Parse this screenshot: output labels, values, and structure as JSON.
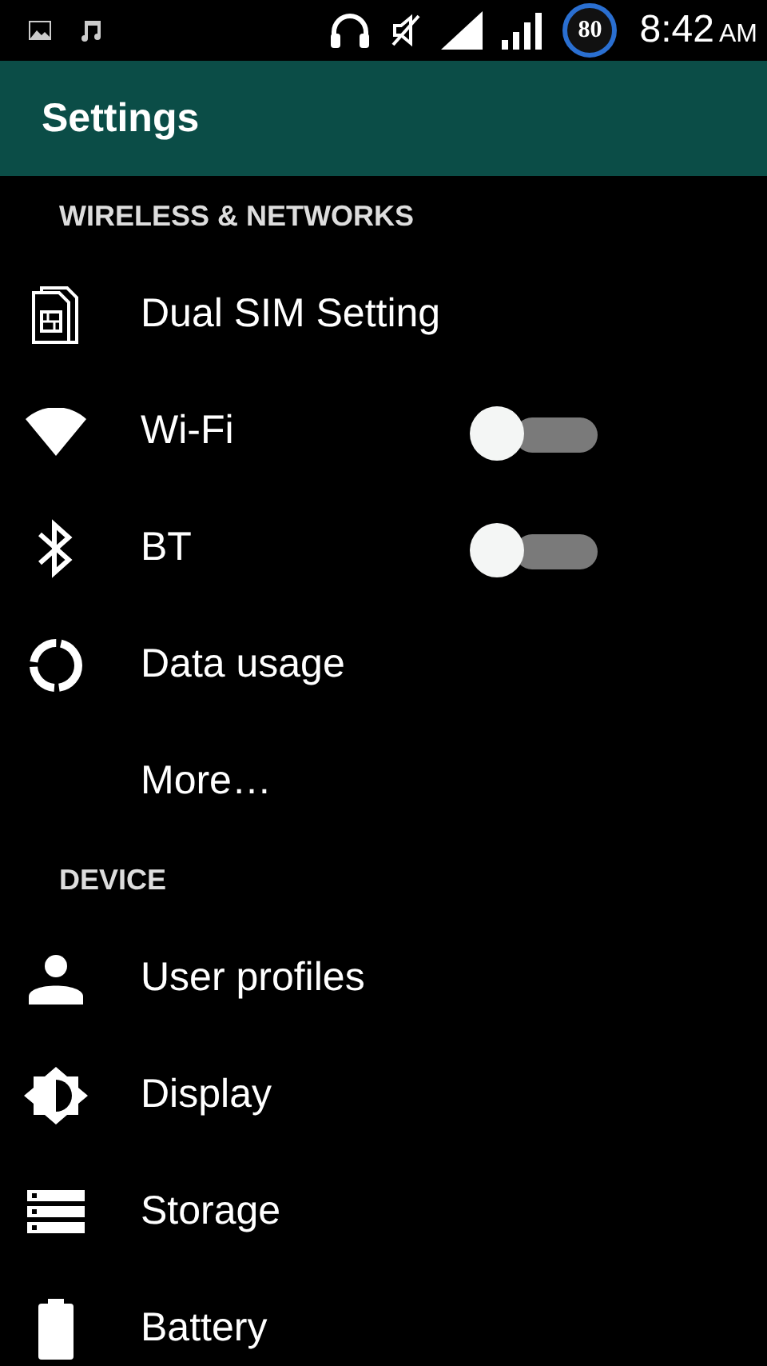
{
  "status_bar": {
    "battery": "80",
    "time": "8:42",
    "period": "AM"
  },
  "app_bar": {
    "title": "Settings"
  },
  "sections": [
    {
      "header": "WIRELESS & NETWORKS",
      "items": [
        {
          "kind": "link",
          "label": "Dual SIM Setting"
        },
        {
          "kind": "toggle",
          "label": "Wi-Fi",
          "on": false
        },
        {
          "kind": "toggle",
          "label": "BT",
          "on": false
        },
        {
          "kind": "link",
          "label": "Data usage"
        },
        {
          "kind": "link",
          "label": "More…"
        }
      ]
    },
    {
      "header": "DEVICE",
      "items": [
        {
          "kind": "link",
          "label": "User profiles"
        },
        {
          "kind": "link",
          "label": "Display"
        },
        {
          "kind": "link",
          "label": "Storage"
        },
        {
          "kind": "link",
          "label": "Battery"
        }
      ]
    }
  ]
}
